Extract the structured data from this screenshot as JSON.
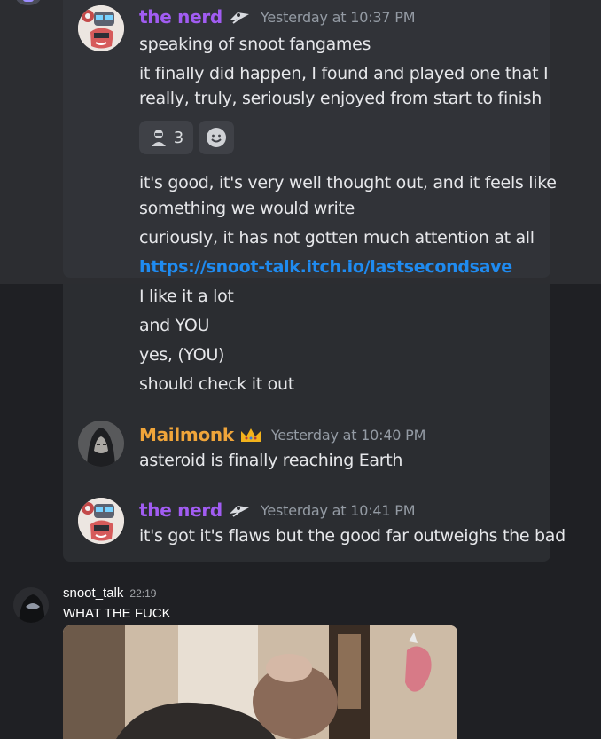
{
  "quoted": {
    "message1": {
      "username": "the nerd",
      "timestamp": "Yesterday at 10:37 PM",
      "lines": [
        "speaking of snoot fangames",
        "it finally did happen, I found and played one that I",
        "really, truly, seriously enjoyed from start to finish"
      ],
      "reactions": [
        {
          "emoji": "person-emoji-icon",
          "count": "3"
        },
        {
          "emoji": "add-reaction-icon"
        }
      ],
      "lines2": [
        "it's good, it's very well thought out, and it feels like",
        "something we would write",
        "curiously, it has not gotten much attention at all"
      ],
      "link": "https://snoot-talk.itch.io/lastsecondsave",
      "lines3": [
        "I like it a lot",
        "and YOU",
        "yes, (YOU)",
        "should check it out"
      ]
    },
    "message2": {
      "username": "Mailmonk",
      "badge": "crown-icon",
      "timestamp": "Yesterday at 10:40 PM",
      "text": "asteroid is finally reaching Earth"
    },
    "message3": {
      "username": "the nerd",
      "timestamp": "Yesterday at 10:41 PM",
      "text": "it's got it's flaws but the good far outweighs the bad"
    }
  },
  "reply": {
    "username": "snoot_talk",
    "timestamp": "22:19",
    "text": "WHAT THE FUCK",
    "attachment": "video-thumbnail"
  },
  "colors": {
    "nerd_name": "#a15cf2",
    "mailmonk_name": "#f0a53a",
    "link": "#1f8bf0",
    "background": "#1f2024",
    "embed": "#313338"
  }
}
